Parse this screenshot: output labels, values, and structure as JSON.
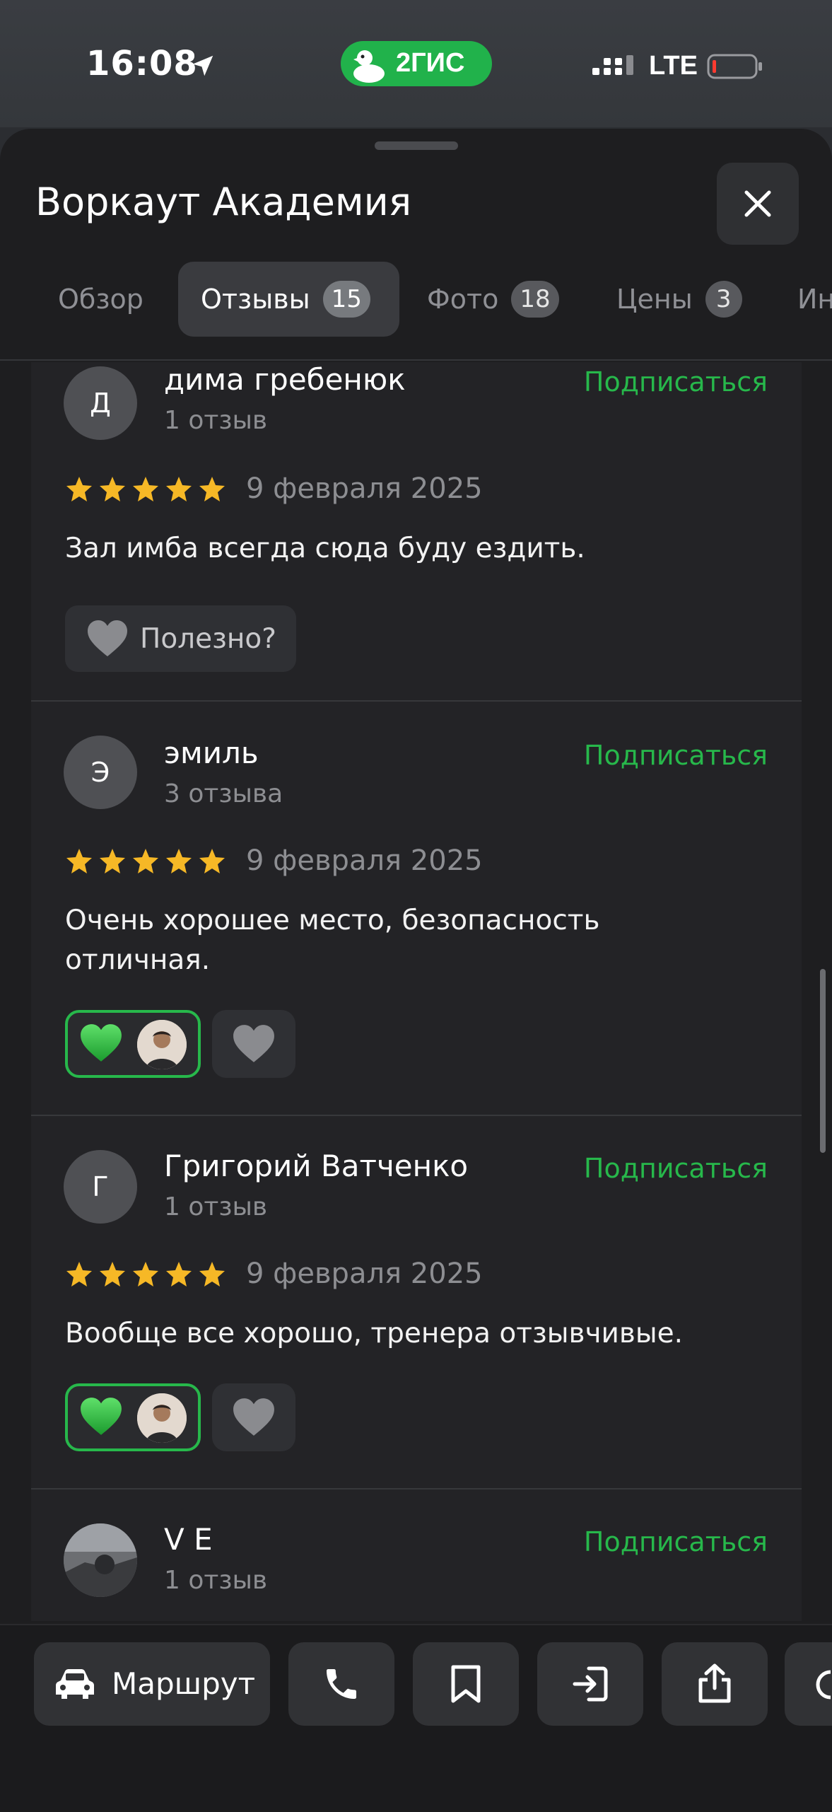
{
  "status_bar": {
    "time": "16:08",
    "network": "LTE",
    "app_badge": "2ГИС",
    "brand_color": "#21b24b"
  },
  "header": {
    "title": "Воркаут Академия",
    "close_icon": "close-icon"
  },
  "tabs": [
    {
      "label": "Обзор",
      "count": "",
      "active": false
    },
    {
      "label": "Отзывы",
      "count": "15",
      "active": true
    },
    {
      "label": "Фото",
      "count": "18",
      "active": false
    },
    {
      "label": "Цены",
      "count": "3",
      "active": false
    },
    {
      "label": "Ин",
      "count": "",
      "active": false
    }
  ],
  "reviews": [
    {
      "avatar_letter": "Д",
      "name": "дима гребенюк",
      "meta": "1 отзыв",
      "subscribe": "Подписаться",
      "rating": 5,
      "date": "9 февраля 2025",
      "text": "Зал имба всегда сюда буду ездить.",
      "useful_label": "Полезно?"
    },
    {
      "avatar_letter": "Э",
      "name": "эмиль",
      "meta": "3 отзыва",
      "subscribe": "Подписаться",
      "rating": 5,
      "date": "9 февраля 2025",
      "text_line1": "Очень хорошее место, безопасность",
      "text_line2": "отличная."
    },
    {
      "avatar_letter": "Г",
      "name": "Григорий Ватченко",
      "meta": "1 отзыв",
      "subscribe": "Подписаться",
      "rating": 5,
      "date": "9 февраля 2025",
      "text": "Вообще все хорошо, тренера отзывчивые."
    },
    {
      "name": "V E",
      "meta": "1 отзыв",
      "subscribe": "Подписаться"
    }
  ],
  "bottom_bar": {
    "route_label": "Маршрут",
    "icons": [
      "car-icon",
      "phone-icon",
      "bookmark-icon",
      "enter-icon",
      "share-icon"
    ]
  },
  "colors": {
    "accent_green": "#27b84b",
    "star_yellow": "#f6b826",
    "sheet_bg": "#1e1e20"
  }
}
